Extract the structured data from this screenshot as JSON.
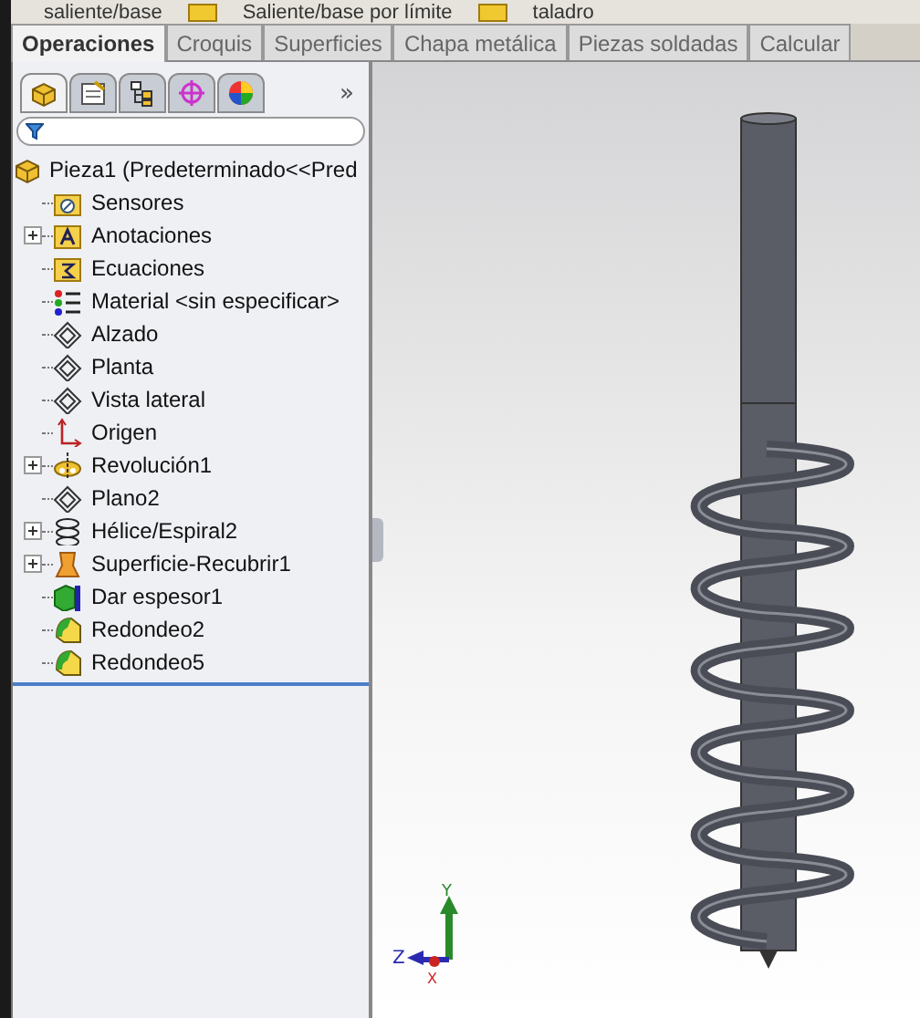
{
  "toolbar": {
    "items": [
      {
        "label": "saliente/base"
      },
      {
        "label": "Saliente/base por límite"
      },
      {
        "label": "taladro"
      }
    ]
  },
  "tabs": [
    {
      "label": "Operaciones",
      "selected": true
    },
    {
      "label": "Croquis",
      "selected": false
    },
    {
      "label": "Superficies",
      "selected": false
    },
    {
      "label": "Chapa metálica",
      "selected": false
    },
    {
      "label": "Piezas soldadas",
      "selected": false
    },
    {
      "label": "Calcular",
      "selected": false
    }
  ],
  "panel": {
    "tabs": [
      {
        "kind": "tree",
        "selected": true
      },
      {
        "kind": "properties",
        "selected": false
      },
      {
        "kind": "config",
        "selected": false
      },
      {
        "kind": "target",
        "selected": false
      },
      {
        "kind": "display",
        "selected": false
      }
    ],
    "more": "»"
  },
  "tree": {
    "label": "Pieza1  (Predeterminado<<Pred",
    "children": [
      {
        "label": "Sensores",
        "kind": "sensor",
        "expandable": false
      },
      {
        "label": "Anotaciones",
        "kind": "annotation",
        "expandable": true
      },
      {
        "label": "Ecuaciones",
        "kind": "equation",
        "expandable": false
      },
      {
        "label": "Material <sin especificar>",
        "kind": "material",
        "expandable": false
      },
      {
        "label": "Alzado",
        "kind": "plane",
        "expandable": false
      },
      {
        "label": "Planta",
        "kind": "plane",
        "expandable": false
      },
      {
        "label": "Vista lateral",
        "kind": "plane",
        "expandable": false
      },
      {
        "label": "Origen",
        "kind": "origin",
        "expandable": false
      },
      {
        "label": "Revolución1",
        "kind": "revolve",
        "expandable": true
      },
      {
        "label": "Plano2",
        "kind": "plane",
        "expandable": false
      },
      {
        "label": "Hélice/Espiral2",
        "kind": "helix",
        "expandable": true
      },
      {
        "label": "Superficie-Recubrir1",
        "kind": "loft",
        "expandable": true
      },
      {
        "label": "Dar espesor1",
        "kind": "thicken",
        "expandable": false
      },
      {
        "label": "Redondeo2",
        "kind": "fillet",
        "expandable": false
      },
      {
        "label": "Redondeo5",
        "kind": "fillet",
        "expandable": false
      }
    ]
  },
  "triad": {
    "x": "X",
    "y": "Y",
    "z": "Z"
  }
}
